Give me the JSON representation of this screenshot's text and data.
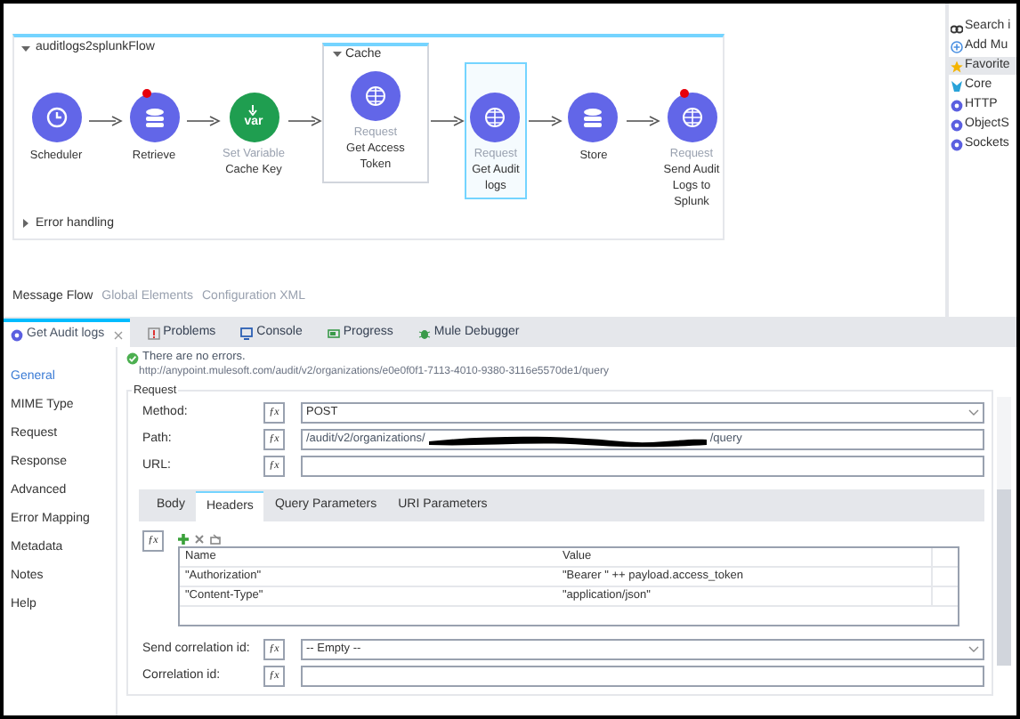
{
  "flow": {
    "title": "auditlogs2splunkFlow",
    "error_handling": "Error handling",
    "nodes": [
      {
        "kind": "scheduler",
        "label": "Scheduler",
        "error": false,
        "selected": false
      },
      {
        "kind": "retrieve",
        "label": "Retrieve",
        "error": true,
        "selected": false
      },
      {
        "kind": "set-variable",
        "badge": "var",
        "type": "Set Variable",
        "label": "Cache Key",
        "error": false,
        "selected": false
      },
      {
        "kind": "scope",
        "title": "Cache",
        "children": [
          {
            "kind": "request",
            "type": "Request",
            "label": "Get Access Token",
            "error": false,
            "selected": false
          }
        ]
      },
      {
        "kind": "request",
        "type": "Request",
        "label": "Get Audit logs",
        "error": false,
        "selected": true
      },
      {
        "kind": "store",
        "label": "Store",
        "error": false,
        "selected": false
      },
      {
        "kind": "request",
        "type": "Request",
        "label": "Send Audit Logs to Splunk",
        "error": true,
        "selected": false
      }
    ]
  },
  "editor_tabs": [
    {
      "label": "Message Flow",
      "selected": true
    },
    {
      "label": "Global Elements",
      "selected": false
    },
    {
      "label": "Configuration XML",
      "selected": false
    }
  ],
  "palette": [
    {
      "kind": "search",
      "label": "Search i"
    },
    {
      "kind": "add",
      "label": "Add Mu"
    },
    {
      "kind": "favorites",
      "label": "Favorite",
      "selected": true
    },
    {
      "kind": "core",
      "label": "Core",
      "selected": false
    },
    {
      "kind": "connector",
      "label": "HTTP",
      "selected": false
    },
    {
      "kind": "connector",
      "label": "ObjectS",
      "selected": false
    },
    {
      "kind": "connector",
      "label": "Sockets",
      "selected": false
    }
  ],
  "views": [
    {
      "kind": "editor",
      "label": "Get Audit logs",
      "selected": true,
      "closable": true
    },
    {
      "kind": "problems",
      "label": "Problems",
      "selected": false
    },
    {
      "kind": "console",
      "label": "Console",
      "selected": false
    },
    {
      "kind": "progress",
      "label": "Progress",
      "selected": false
    },
    {
      "kind": "debugger",
      "label": "Mule Debugger",
      "selected": false
    }
  ],
  "status": "There are no errors.",
  "url": "http://anypoint.mulesoft.com/audit/v2/organizations/e0e0f0f1-7113-4010-9380-3116e5570de1/query",
  "nav": [
    {
      "label": "General",
      "selected": true
    },
    {
      "label": "MIME Type",
      "selected": false
    },
    {
      "label": "Request",
      "selected": false
    },
    {
      "label": "Response",
      "selected": false
    },
    {
      "label": "Advanced",
      "selected": false
    },
    {
      "label": "Error Mapping",
      "selected": false
    },
    {
      "label": "Metadata",
      "selected": false
    },
    {
      "label": "Notes",
      "selected": false
    },
    {
      "label": "Help",
      "selected": false
    }
  ],
  "request": {
    "title": "Request",
    "fields": [
      {
        "kind": "select",
        "label": "Method:",
        "fx": "ƒx",
        "value": "POST"
      },
      {
        "kind": "redacted",
        "label": "Path:",
        "fx": "ƒx",
        "value": "/audit/v2/organizations/",
        "suffix": "/query"
      },
      {
        "kind": "text",
        "label": "URL:",
        "fx": "ƒx"
      }
    ],
    "tabs": [
      {
        "label": "Body",
        "selected": false
      },
      {
        "label": "Headers",
        "selected": true
      },
      {
        "label": "Query Parameters",
        "selected": false
      },
      {
        "label": "URI Parameters",
        "selected": false
      }
    ],
    "headers": {
      "fx": "ƒx",
      "columns": [
        "Name",
        "Value"
      ],
      "rows": [
        [
          "\"Authorization\"",
          "\"Bearer \" ++ payload.access_token"
        ],
        [
          "\"Content-Type\"",
          "\"application/json\""
        ]
      ]
    }
  },
  "correlation": [
    {
      "kind": "select",
      "label": "Send correlation id:",
      "fx": "ƒx",
      "value": "-- Empty --"
    },
    {
      "kind": "text",
      "label": "Correlation id:",
      "fx": "ƒx"
    }
  ]
}
